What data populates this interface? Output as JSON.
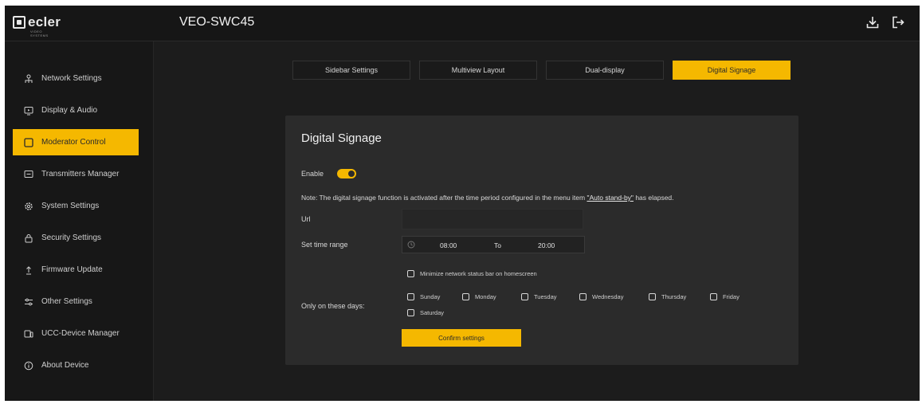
{
  "brand": {
    "name": "ecler",
    "tagline": "VIDEO SYSTEMS"
  },
  "header": {
    "device_name": "VEO-SWC45",
    "download_icon": "download-icon",
    "logout_icon": "logout-icon"
  },
  "sidebar": {
    "items": [
      {
        "label": "Network Settings",
        "icon": "network-icon"
      },
      {
        "label": "Display & Audio",
        "icon": "display-icon"
      },
      {
        "label": "Moderator Control",
        "icon": "moderator-icon",
        "active": true
      },
      {
        "label": "Transmitters Manager",
        "icon": "transmitter-icon"
      },
      {
        "label": "System Settings",
        "icon": "gear-icon"
      },
      {
        "label": "Security Settings",
        "icon": "lock-icon"
      },
      {
        "label": "Firmware Update",
        "icon": "upload-icon"
      },
      {
        "label": "Other Settings",
        "icon": "sliders-icon"
      },
      {
        "label": "UCC-Device Manager",
        "icon": "device-icon"
      },
      {
        "label": "About Device",
        "icon": "info-icon"
      }
    ]
  },
  "tabs": [
    {
      "label": "Sidebar Settings"
    },
    {
      "label": "Multiview Layout"
    },
    {
      "label": "Dual-display"
    },
    {
      "label": "Digital Signage",
      "active": true
    }
  ],
  "panel": {
    "title": "Digital Signage",
    "enable_label": "Enable",
    "enabled": true,
    "note_prefix": "Note: The digital signage function is activated after the time period configured in the menu item ",
    "note_link": "\"Auto stand-by\"",
    "note_suffix": " has elapsed.",
    "url_label": "Url",
    "url_value": "",
    "time_label": "Set time range",
    "time_from": "08:00",
    "time_to_label": "To",
    "time_to": "20:00",
    "minimize_label": "Minimize network status bar on homescreen",
    "days_label": "Only on these days:",
    "days": [
      "Sunday",
      "Monday",
      "Tuesday",
      "Wednesday",
      "Thursday",
      "Friday",
      "Saturday"
    ],
    "confirm_label": "Confirm settings"
  },
  "colors": {
    "accent": "#f5b800",
    "background": "#1c1c1c",
    "panel": "#2b2b2b",
    "sidebar": "#171717"
  }
}
